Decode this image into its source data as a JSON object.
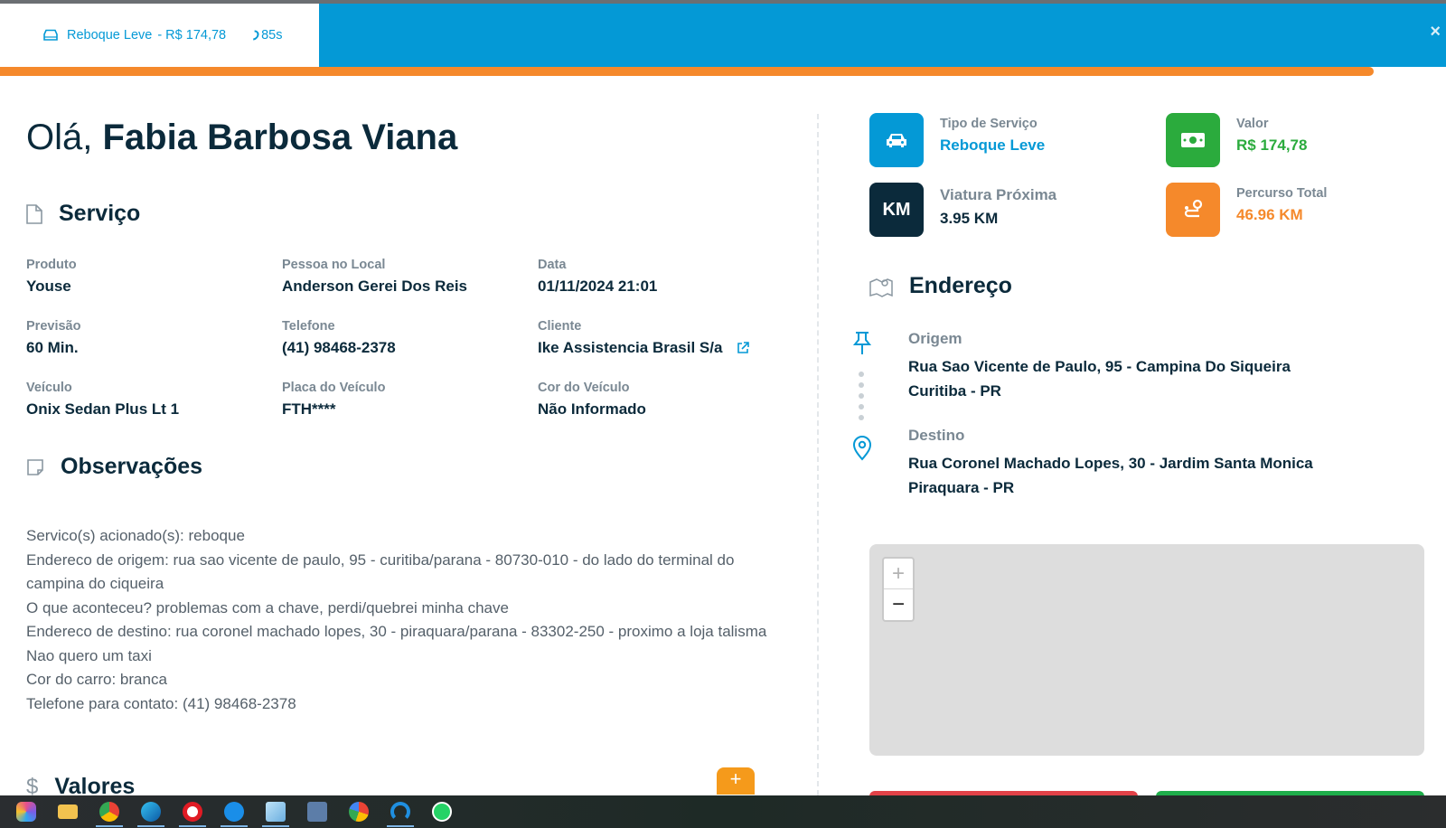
{
  "header": {
    "service_label": "Reboque Leve",
    "price_label": "- R$ 174,78",
    "timer": "85s",
    "close_label": "×",
    "progress_fraction": 0.95
  },
  "greeting": {
    "prefix": "Olá,",
    "name": "Fabia Barbosa Viana"
  },
  "servico": {
    "title": "Serviço",
    "fields": [
      {
        "label": "Produto",
        "value": "Youse"
      },
      {
        "label": "Pessoa no Local",
        "value": "Anderson Gerei Dos Reis"
      },
      {
        "label": "Data",
        "value": "01/11/2024 21:01"
      },
      {
        "label": "Previsão",
        "value": "60 Min."
      },
      {
        "label": "Telefone",
        "value": "(41) 98468-2378"
      },
      {
        "label": "Cliente",
        "value": "Ike Assistencia Brasil S/a"
      },
      {
        "label": "Veículo",
        "value": "Onix Sedan Plus Lt 1"
      },
      {
        "label": "Placa do Veículo",
        "value": "FTH****"
      },
      {
        "label": "Cor do Veículo",
        "value": "Não Informado"
      }
    ]
  },
  "observacoes": {
    "title": "Observações",
    "lines": [
      "Servico(s) acionado(s): reboque",
      "Endereco de origem: rua sao vicente de paulo, 95 - curitiba/parana - 80730-010 - do lado do terminal do campina do ciqueira",
      "O que aconteceu? problemas com a chave, perdi/quebrei minha chave",
      "Endereco de destino: rua coronel machado lopes, 30 - piraquara/parana - 83302-250 - proximo a loja talisma",
      "Nao quero um taxi",
      "Cor do carro: branca",
      "Telefone para contato: (41) 98468-2378"
    ]
  },
  "valores": {
    "title": "Valores",
    "add_label": "+"
  },
  "stats": {
    "tipo": {
      "label": "Tipo de Serviço",
      "value": "Reboque Leve",
      "color": "#0499d6"
    },
    "valor": {
      "label": "Valor",
      "value": "R$ 174,78",
      "color": "#2bab3d"
    },
    "viatura": {
      "label": "Viatura Próxima",
      "value": "3.95 KM",
      "badge": "KM",
      "color": "#0b2a3b"
    },
    "percurso": {
      "label": "Percurso Total",
      "value": "46.96 KM",
      "color": "#f5892b"
    }
  },
  "endereco": {
    "title": "Endereço",
    "origem": {
      "label": "Origem",
      "line1": "Rua Sao Vicente de Paulo, 95 - Campina Do Siqueira",
      "line2": "Curitiba - PR"
    },
    "destino": {
      "label": "Destino",
      "line1": "Rua Coronel Machado Lopes, 30 - Jardim Santa Monica",
      "line2": "Piraquara - PR"
    }
  },
  "map": {
    "zoom_in": "+",
    "zoom_out": "−"
  },
  "taskbar": {
    "icons": [
      "copilot-icon",
      "file-explorer-icon",
      "chrome-icon",
      "edge-icon",
      "opera-icon",
      "skype-icon",
      "notepad-icon",
      "calculator-icon",
      "maps-icon",
      "app-icon",
      "whatsapp-icon"
    ]
  }
}
